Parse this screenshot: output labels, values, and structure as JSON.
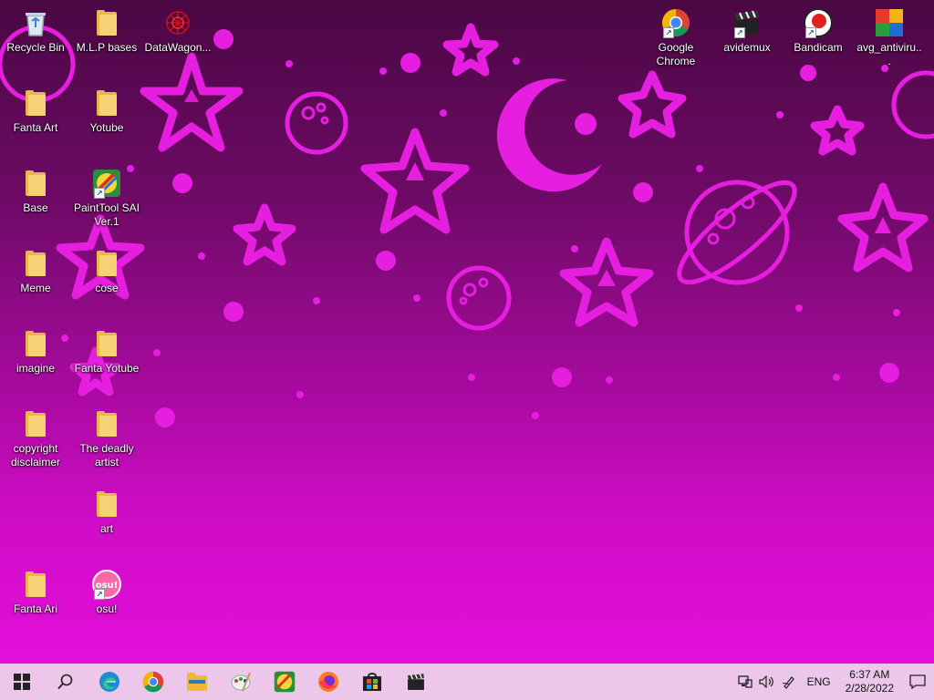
{
  "desktop_icons_left": [
    {
      "id": "recycle-bin",
      "label": "Recycle Bin",
      "icon": "recycle-bin-icon"
    },
    {
      "id": "mlp-bases",
      "label": "M.L.P bases",
      "icon": "folder-icon"
    },
    {
      "id": "datawagon",
      "label": "DataWagon...",
      "icon": "datawagon-icon"
    },
    {
      "id": "fanta-art",
      "label": "Fanta Art",
      "icon": "folder-icon"
    },
    {
      "id": "yotube",
      "label": "Yotube",
      "icon": "folder-icon"
    },
    {
      "id": "base",
      "label": "Base",
      "icon": "folder-icon"
    },
    {
      "id": "painttool-sai",
      "label": "PaintTool SAI Ver.1",
      "icon": "painttool-sai-icon"
    },
    {
      "id": "meme",
      "label": "Meme",
      "icon": "folder-icon"
    },
    {
      "id": "cose",
      "label": "cose",
      "icon": "folder-icon"
    },
    {
      "id": "imagine",
      "label": "imagine",
      "icon": "folder-icon"
    },
    {
      "id": "fanta-yotube",
      "label": "Fanta Yotube",
      "icon": "folder-icon"
    },
    {
      "id": "copyright-disclaimer",
      "label": "copyright disclaimer",
      "icon": "folder-icon"
    },
    {
      "id": "the-deadly-artist",
      "label": "The deadly artist",
      "icon": "folder-icon"
    },
    {
      "id": "art",
      "label": "art",
      "icon": "folder-icon"
    },
    {
      "id": "fanta-ari",
      "label": "Fanta Ari",
      "icon": "folder-icon"
    },
    {
      "id": "osu",
      "label": "osu!",
      "icon": "osu-icon"
    }
  ],
  "desktop_icons_right": [
    {
      "id": "google-chrome",
      "label": "Google Chrome",
      "icon": "chrome-icon"
    },
    {
      "id": "avidemux",
      "label": "avidemux",
      "icon": "avidemux-icon"
    },
    {
      "id": "bandicam",
      "label": "Bandicam",
      "icon": "bandicam-icon"
    },
    {
      "id": "avg-antivirus",
      "label": "avg_antiviru...",
      "icon": "avg-icon"
    }
  ],
  "taskbar": {
    "pinned": [
      "start-icon",
      "search-icon",
      "edge-icon",
      "chrome-icon",
      "file-explorer-icon",
      "paint-icon",
      "painttool-sai-icon",
      "firefox-icon",
      "store-icon",
      "avidemux-icon"
    ],
    "tray": {
      "lang": "ENG",
      "time": "6:37 AM",
      "date": "2/28/2022",
      "icons": [
        "network-icon",
        "volume-icon",
        "pen-icon"
      ]
    }
  },
  "colors": {
    "taskbar": "#edc7ea",
    "wallpaper_accent": "#e61ee0",
    "folder": "#f7d275"
  }
}
